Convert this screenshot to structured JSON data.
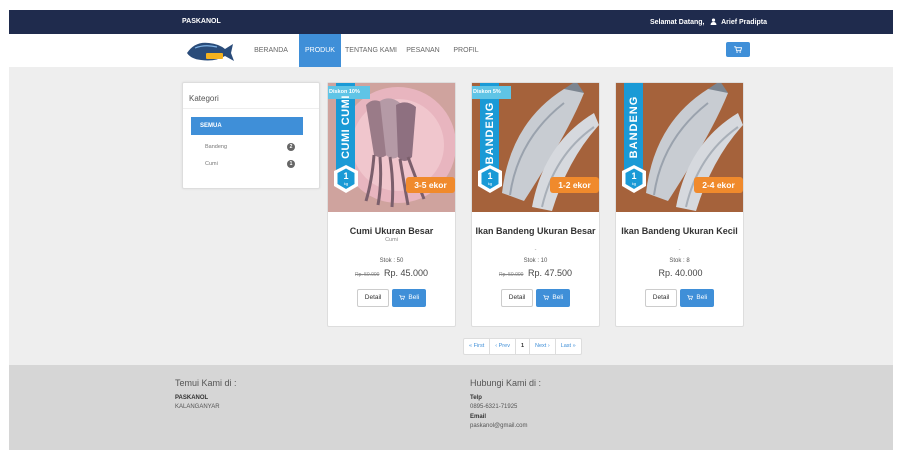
{
  "topbar": {
    "brand": "PASKANOL",
    "welcome": "Selamat Datang,",
    "user": "Arief Pradipta"
  },
  "nav": {
    "logo_text": "PASAR IKAN",
    "items": [
      "BERANDA",
      "PRODUK",
      "TENTANG KAMI",
      "PESANAN",
      "PROFIL"
    ],
    "active": "PRODUK"
  },
  "sidebar": {
    "title": "Kategori",
    "all_label": "SEMUA",
    "categories": [
      {
        "label": "Bandeng",
        "count": "2"
      },
      {
        "label": "Cumi",
        "count": "1"
      }
    ]
  },
  "products": [
    {
      "discount": "Diskon 10%",
      "banner": "CUMI CUMI",
      "weight": "1",
      "unit": "kg",
      "size": "3-5 ekor",
      "name": "Cumi Ukuran Besar",
      "sub": "Cumi",
      "stock": "Stok : 50",
      "old_price": "Rp. 50.000",
      "price": "Rp. 45.000",
      "detail": "Detail",
      "buy": "Beli"
    },
    {
      "discount": "Diskon 5%",
      "banner": "BANDENG",
      "weight": "1",
      "unit": "kg",
      "size": "1-2 ekor",
      "name": "Ikan Bandeng Ukuran Besar",
      "sub": "-",
      "stock": "Stok : 10",
      "old_price": "Rp. 50.000",
      "price": "Rp. 47.500",
      "detail": "Detail",
      "buy": "Beli"
    },
    {
      "discount": "",
      "banner": "BANDENG",
      "weight": "1",
      "unit": "kg",
      "size": "2-4 ekor",
      "name": "Ikan Bandeng Ukuran Kecil",
      "sub": "-",
      "stock": "Stok : 8",
      "old_price": "",
      "price": "Rp. 40.000",
      "detail": "Detail",
      "buy": "Beli"
    }
  ],
  "pagination": {
    "first": "« First",
    "prev": "‹ Prev",
    "current": "1",
    "next": "Next ›",
    "last": "Last »"
  },
  "footer": {
    "left_title": "Temui Kami di :",
    "left_name": "PASKANOL",
    "left_address": "KALANGANYAR",
    "right_title": "Hubungi Kami di :",
    "telp_label": "Telp",
    "telp": "0895-6321-71925",
    "email_label": "Email",
    "email": "paskanol@gmail.com"
  },
  "colors": {
    "topbar": "#1f2b4d",
    "accent": "#3f8fd8",
    "discount": "#5fc4e6",
    "banner": "#1a9ad6",
    "size_tag": "#f08a2c"
  }
}
